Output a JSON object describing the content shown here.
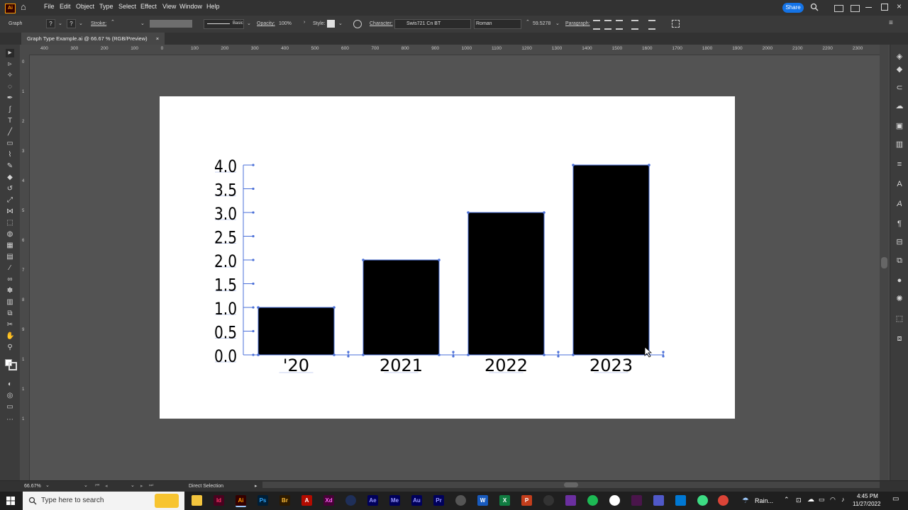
{
  "app": {
    "name": "Ai",
    "home": "⌂"
  },
  "menu": [
    "File",
    "Edit",
    "Object",
    "Type",
    "Select",
    "Effect",
    "View",
    "Window",
    "Help"
  ],
  "share_label": "Share",
  "control_bar": {
    "selection_type": "Graph",
    "stroke_label": "Stroke:",
    "brush_label": "Basic",
    "opacity_label": "Opacity:",
    "opacity_value": "100%",
    "style_label": "Style:",
    "character_label": "Character:",
    "font_name": "Swis721 Cn BT",
    "font_style": "Roman",
    "font_size": "59.5278",
    "paragraph_label": "Paragraph:",
    "fill_value": "?",
    "stroke_value": "?"
  },
  "document_tab": {
    "title": "Graph Type Example.ai @ 66.67 % (RGB/Preview)",
    "close": "×"
  },
  "ruler": {
    "horizontal": [
      "400",
      "300",
      "200",
      "100",
      "0",
      "100",
      "200",
      "300",
      "400",
      "500",
      "600",
      "700",
      "800",
      "900",
      "1000",
      "1100",
      "1200",
      "1300",
      "1400",
      "1500",
      "1600",
      "1700",
      "1800",
      "1900",
      "2000",
      "2100",
      "2200",
      "2300"
    ],
    "vertical": [
      "0",
      "1",
      "2",
      "3",
      "4",
      "5",
      "6",
      "7",
      "8",
      "9",
      "1",
      "1",
      "1"
    ]
  },
  "status": {
    "zoom": "66.67%",
    "tool": "Direct Selection"
  },
  "chart_data": {
    "type": "bar",
    "categories": [
      "'20",
      "2021",
      "2022",
      "2023"
    ],
    "values": [
      1.0,
      2.0,
      3.0,
      4.0
    ],
    "ylim": [
      0,
      4.0
    ],
    "y_ticks": [
      "0.0",
      "0.5",
      "1.0",
      "1.5",
      "2.0",
      "2.5",
      "3.0",
      "3.5",
      "4.0"
    ],
    "bar_color": "#000000",
    "selection_color": "#4a6fd8"
  },
  "taskbar": {
    "search_placeholder": "Type here to search",
    "weather": "Rain...",
    "time": "4:45 PM",
    "date": "11/27/2022",
    "apps": [
      "Id",
      "Ai",
      "Ps",
      "Br",
      "A",
      "Xd",
      "Ae",
      "Me",
      "Au",
      "Pr",
      "W",
      "X",
      "P"
    ]
  },
  "colors": {
    "ai_brand": "#ff9a00",
    "share": "#1473e6",
    "dark": "#323232"
  }
}
